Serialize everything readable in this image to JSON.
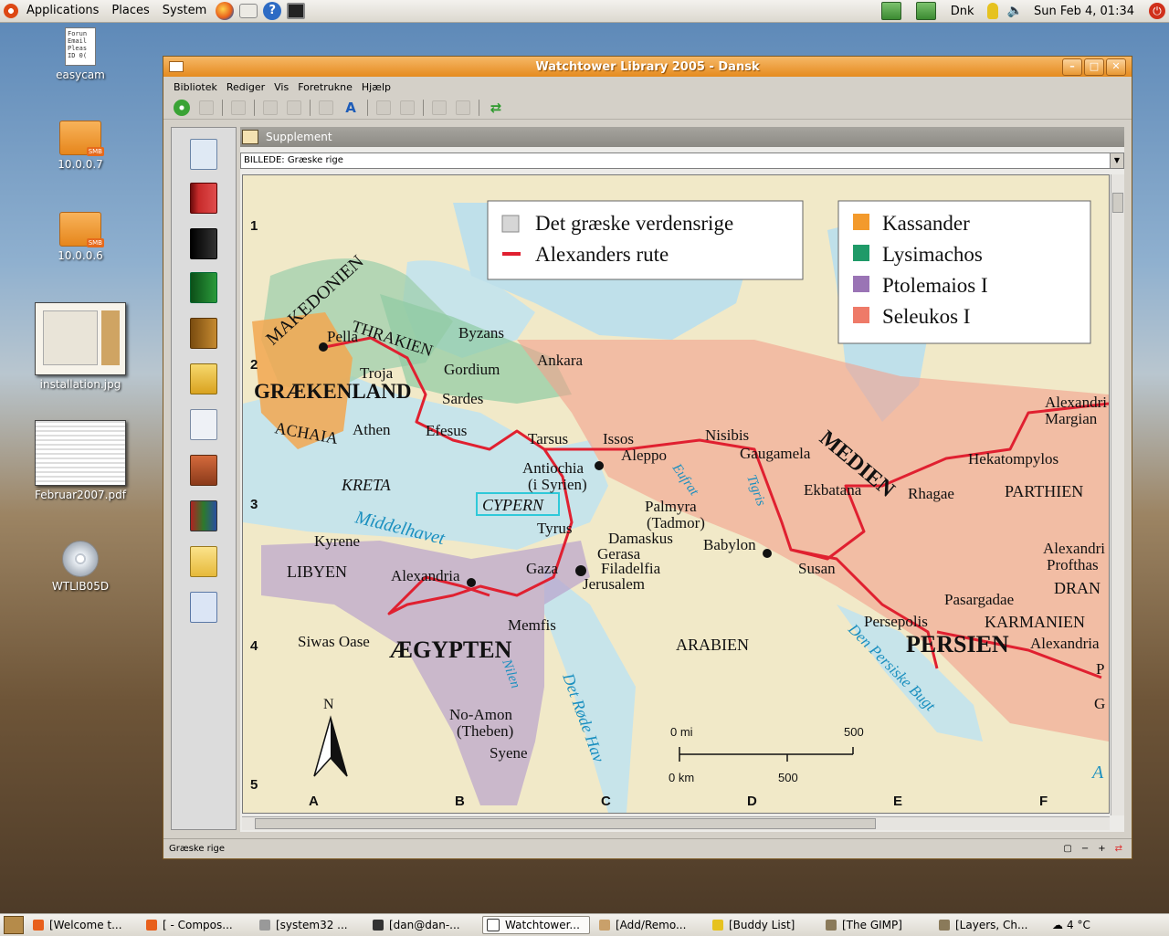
{
  "top_panel": {
    "menus": [
      "Applications",
      "Places",
      "System"
    ],
    "keyboard": "Dnk",
    "clock": "Sun Feb  4, 01:34"
  },
  "desktop": {
    "icons": [
      {
        "label": "easycam"
      },
      {
        "label": "10.0.0.7"
      },
      {
        "label": "10.0.0.6"
      },
      {
        "label": "installation.jpg"
      },
      {
        "label": "Februar2007.pdf"
      },
      {
        "label": "WTLIB05D"
      }
    ],
    "doc_preview": [
      "Forun",
      "Email",
      "Pleas",
      "ID 0("
    ],
    "smb_badge": "SMB"
  },
  "window": {
    "title": "Watchtower Library 2005 - Dansk",
    "menu": [
      "Bibliotek",
      "Rediger",
      "Vis",
      "Foretrukne",
      "Hjælp"
    ],
    "panel_title": "Supplement",
    "picture_select": "BILLEDE: Græske rige",
    "status": "Græske rige",
    "status_controls": [
      "−",
      "+"
    ]
  },
  "map": {
    "legend1": [
      "Det græske verdensrige",
      "Alexanders rute"
    ],
    "legend2": [
      "Kassander",
      "Lysimachos",
      "Ptolemaios I",
      "Seleukos I"
    ],
    "colors": {
      "kassander": "#f39a2c",
      "lysimachos": "#1f9a68",
      "ptolemaios": "#9a74b5",
      "seleukos": "#ee7a68",
      "route": "#e02030",
      "greek": "#d6d6d6"
    },
    "rows": [
      "1",
      "2",
      "3",
      "4",
      "5"
    ],
    "cols": [
      "A",
      "B",
      "C",
      "D",
      "E",
      "F"
    ],
    "regions": [
      "MAKEDONIEN",
      "THRAKIEN",
      "GRÆKENLAND",
      "ACHAIA",
      "KRETA",
      "CYPERN",
      "LIBYEN",
      "ÆGYPTEN",
      "ARABIEN",
      "MEDIEN",
      "PARTHIEN",
      "KARMANIEN",
      "PERSIEN",
      "DRAN"
    ],
    "cities": [
      "Pella",
      "Byzans",
      "Troja",
      "Gordium",
      "Ankara",
      "Sardes",
      "Athen",
      "Efesus",
      "Tarsus",
      "Issos",
      "Antiochia",
      "(i Syrien)",
      "Aleppo",
      "Nisibis",
      "Gaugamela",
      "Hekatompylos",
      "Rhagae",
      "Ekbatana",
      "Palmyra",
      "(Tadmor)",
      "Tyrus",
      "Damaskus",
      "Gerasa",
      "Filadelfia",
      "Jerusalem",
      "Gaza",
      "Alexandria",
      "Kyrene",
      "Memfis",
      "Siwas Oase",
      "Babylon",
      "Susan",
      "Pasargadae",
      "Persepolis",
      "No-Amon",
      "(Theben)",
      "Syene",
      "Alexandri",
      "Margian",
      "Alexandri",
      "Profthas",
      "Alexandria",
      "P",
      "G"
    ],
    "waters": [
      "Middelhavet",
      "Eufrat",
      "Tigris",
      "Nilen",
      "Det Røde Hav",
      "Den Persiske Bugt",
      "A"
    ],
    "compass": "N",
    "scale": {
      "miles_zero": "0 mi",
      "miles_max": "500",
      "km_zero": "0 km",
      "km_max": "500"
    }
  },
  "taskbar": [
    "[Welcome t...",
    "[ - Compos...",
    "[system32 ...",
    "[dan@dan-...",
    "Watchtower...",
    "[Add/Remo...",
    "[Buddy List]",
    "[The GIMP]",
    "[Layers, Ch..."
  ],
  "weather": "4 °C"
}
